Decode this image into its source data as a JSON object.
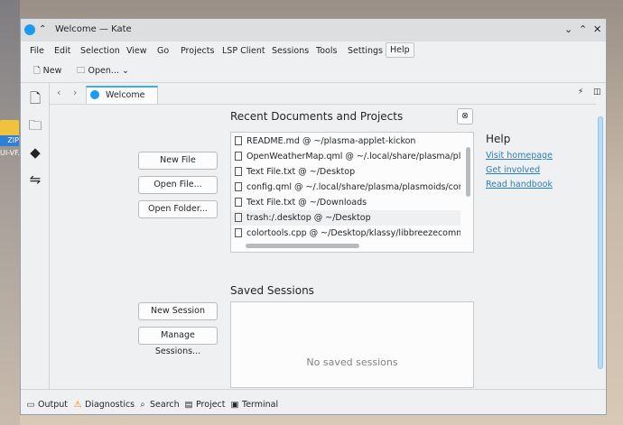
{
  "desktop": {
    "zip_label": "ZIP",
    "file_label": "UI-VF..."
  },
  "window": {
    "title": "Welcome — Kate"
  },
  "menu": [
    "File",
    "Edit",
    "Selection",
    "View",
    "Go",
    "Projects",
    "LSP Client",
    "Sessions",
    "Tools",
    "Settings",
    "Help"
  ],
  "toolbar": {
    "new_label": "New",
    "open_label": "Open..."
  },
  "tab": {
    "label": "Welcome"
  },
  "recent": {
    "title": "Recent Documents and Projects",
    "items": [
      "README.md @ ~/plasma-applet-kickon",
      "OpenWeatherMap.qml @ ~/.local/share/plasma/plasmoid",
      "Text File.txt @ ~/Desktop",
      "config.qml @ ~/.local/share/plasma/plasmoids/com.githu",
      "Text File.txt @ ~/Downloads",
      "trash:/.desktop @ ~/Desktop",
      "colortools.cpp @ ~/Desktop/klassy/libbreezecommon"
    ]
  },
  "actions": {
    "new_file": "New File",
    "open_file": "Open File...",
    "open_folder": "Open Folder..."
  },
  "sessions": {
    "title": "Saved Sessions",
    "empty": "No saved sessions",
    "new_session": "New Session",
    "manage": "Manage Sessions..."
  },
  "help": {
    "title": "Help",
    "links": [
      "Visit homepage",
      "Get involved",
      "Read handbook"
    ]
  },
  "statusbar": [
    "Output",
    "Diagnostics",
    "Search",
    "Project",
    "Terminal"
  ]
}
